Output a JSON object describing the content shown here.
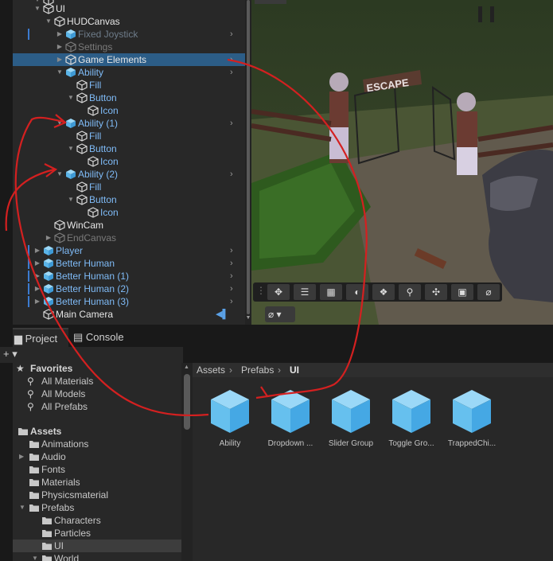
{
  "hierarchy": {
    "rows": [
      {
        "label": "",
        "fold": "▼",
        "icon": "white-box-icon"
      },
      {
        "label": "UI",
        "fold": "▼",
        "icon": "white-box-icon"
      },
      {
        "label": "HUDCanvas",
        "fold": "▼",
        "icon": "white-box-icon"
      },
      {
        "label": "Fixed Joystick",
        "fold": "▶",
        "icon": "blue-prefab-icon"
      },
      {
        "label": "Settings",
        "fold": "▶",
        "icon": "white-box-icon"
      },
      {
        "label": "Game Elements",
        "fold": "▶",
        "icon": "white-box-icon"
      },
      {
        "label": "Ability",
        "fold": "▼",
        "icon": "blue-prefab-icon"
      },
      {
        "label": "Fill",
        "fold": "",
        "icon": "white-box-icon"
      },
      {
        "label": "Button",
        "fold": "▼",
        "icon": "white-box-icon"
      },
      {
        "label": "Icon",
        "fold": "",
        "icon": "white-box-icon"
      },
      {
        "label": "Ability (1)",
        "fold": "▼",
        "icon": "blue-prefab-icon"
      },
      {
        "label": "Fill",
        "fold": "",
        "icon": "white-box-icon"
      },
      {
        "label": "Button",
        "fold": "▼",
        "icon": "white-box-icon"
      },
      {
        "label": "Icon",
        "fold": "",
        "icon": "white-box-icon"
      },
      {
        "label": "Ability (2)",
        "fold": "▼",
        "icon": "blue-prefab-icon"
      },
      {
        "label": "Fill",
        "fold": "",
        "icon": "white-box-icon"
      },
      {
        "label": "Button",
        "fold": "▼",
        "icon": "white-box-icon"
      },
      {
        "label": "Icon",
        "fold": "",
        "icon": "white-box-icon"
      },
      {
        "label": "WinCam",
        "fold": "",
        "icon": "white-box-icon"
      },
      {
        "label": "EndCanvas",
        "fold": "▶",
        "icon": "white-box-icon"
      },
      {
        "label": "Player",
        "fold": "▶",
        "icon": "blue-prefab-icon"
      },
      {
        "label": "Better Human",
        "fold": "▶",
        "icon": "blue-prefab-icon"
      },
      {
        "label": "Better Human (1)",
        "fold": "▶",
        "icon": "blue-prefab-icon"
      },
      {
        "label": "Better Human (2)",
        "fold": "▶",
        "icon": "blue-prefab-icon"
      },
      {
        "label": "Better Human (3)",
        "fold": "▶",
        "icon": "blue-prefab-icon"
      },
      {
        "label": "Main Camera",
        "fold": "",
        "icon": "white-box-icon"
      }
    ],
    "selected": "Game Elements"
  },
  "scene": {
    "sign_text": "ESCAPE",
    "toolbar_icons": [
      "move-tool-icon",
      "rect-align-icon",
      "grid-snap-icon",
      "shading-icon",
      "gizmo-icon",
      "search-icon",
      "pivot-icon",
      "camera-icon",
      "compass-icon"
    ],
    "gizmo_toggle": "compass-icon"
  },
  "tabs": {
    "project": "Project",
    "console": "Console",
    "plus": "+"
  },
  "project_tree": {
    "favorites_label": "Favorites",
    "favorites": [
      "All Materials",
      "All Models",
      "All Prefabs"
    ],
    "assets_label": "Assets",
    "folders": [
      {
        "label": "Animations",
        "fold": ""
      },
      {
        "label": "Audio",
        "fold": "▶"
      },
      {
        "label": "Fonts",
        "fold": ""
      },
      {
        "label": "Materials",
        "fold": ""
      },
      {
        "label": "Physicsmaterial",
        "fold": ""
      },
      {
        "label": "Prefabs",
        "fold": "▼"
      },
      {
        "label": "Characters",
        "fold": ""
      },
      {
        "label": "Particles",
        "fold": ""
      },
      {
        "label": "UI",
        "fold": ""
      },
      {
        "label": "World",
        "fold": "▼"
      }
    ]
  },
  "breadcrumb": [
    "Assets",
    "Prefabs",
    "UI"
  ],
  "assets": [
    {
      "label": "Ability"
    },
    {
      "label": "Dropdown ..."
    },
    {
      "label": "Slider Group"
    },
    {
      "label": "Toggle Gro..."
    },
    {
      "label": "TrappedChi..."
    }
  ],
  "colors": {
    "prefab_blue": "#6ec6f2",
    "selection": "#2c5d87",
    "annotation_red": "#d42020"
  }
}
